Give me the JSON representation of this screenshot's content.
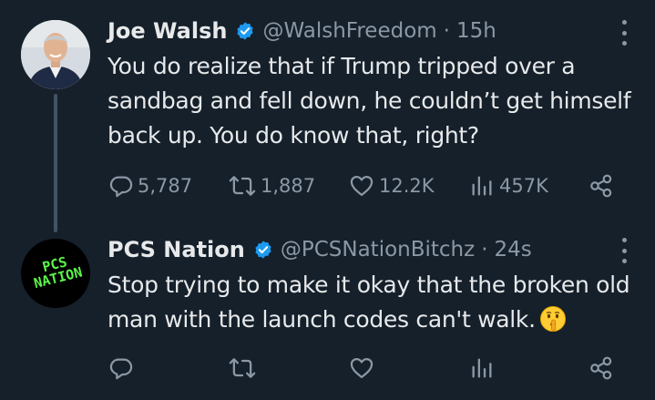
{
  "tweets": [
    {
      "name": "Joe Walsh",
      "handle": "@WalshFreedom",
      "separator": "·",
      "time": "15h",
      "text": "You do realize that if Trump tripped over a sandbag and fell down, he couldn’t get himself back up. You do know that, right?",
      "stats": {
        "replies": "5,787",
        "reposts": "1,887",
        "likes": "12.2K",
        "views": "457K"
      }
    },
    {
      "name": "PCS Nation",
      "handle": "@PCSNationBitchz",
      "separator": "·",
      "time": "24s",
      "text": "Stop trying to make it okay that the broken old man with the launch codes can't walk.",
      "avatar_text_line1": "PCS",
      "avatar_text_line2": "NATION",
      "stats": {
        "replies": "",
        "reposts": "",
        "likes": "",
        "views": ""
      }
    }
  ],
  "icons": {
    "verified": "verified-badge-icon",
    "reply": "reply-icon",
    "repost": "repost-icon",
    "like": "heart-icon",
    "views": "views-icon",
    "share": "share-icon",
    "more": "more-icon",
    "emoji": "shushing-face-emoji"
  },
  "colors": {
    "background": "#15202b",
    "text": "#e7e9ea",
    "secondary": "#8b98a5",
    "verified": "#1d9bf0",
    "thread_line": "#425364",
    "avatar_green": "#5bf54a"
  }
}
